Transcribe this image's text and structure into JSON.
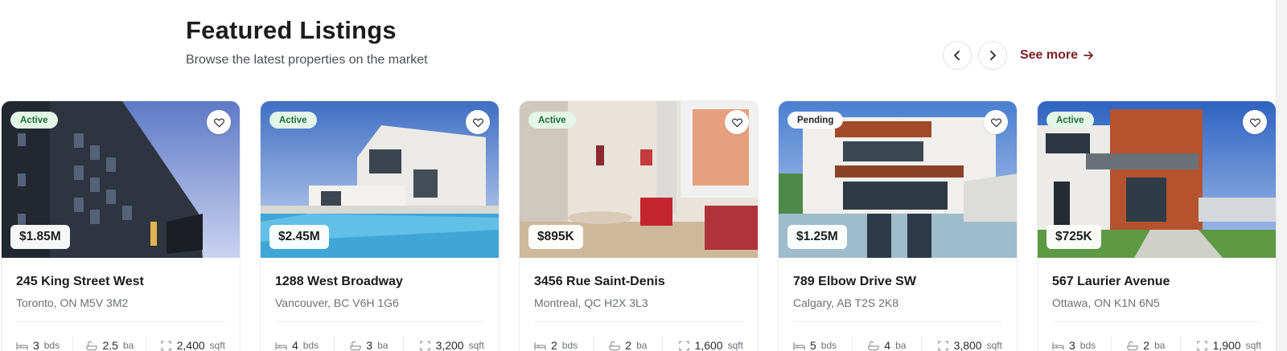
{
  "header": {
    "title": "Featured Listings",
    "subtitle": "Browse the latest properties on the market"
  },
  "controls": {
    "see_more_label": "See more",
    "see_more_color": "#7a1f24"
  },
  "listings": [
    {
      "status": "Active",
      "price": "$1.85M",
      "address": "245 King Street West",
      "city": "Toronto, ON M5V 3M2",
      "beds": "3",
      "beds_unit": "bds",
      "baths": "2.5",
      "baths_unit": "ba",
      "area": "2,400",
      "area_unit": "sqft"
    },
    {
      "status": "Active",
      "price": "$2.45M",
      "address": "1288 West Broadway",
      "city": "Vancouver, BC V6H 1G6",
      "beds": "4",
      "beds_unit": "bds",
      "baths": "3",
      "baths_unit": "ba",
      "area": "3,200",
      "area_unit": "sqft"
    },
    {
      "status": "Active",
      "price": "$895K",
      "address": "3456 Rue Saint-Denis",
      "city": "Montreal, QC H2X 3L3",
      "beds": "2",
      "beds_unit": "bds",
      "baths": "2",
      "baths_unit": "ba",
      "area": "1,600",
      "area_unit": "sqft"
    },
    {
      "status": "Pending",
      "price": "$1.25M",
      "address": "789 Elbow Drive SW",
      "city": "Calgary, AB T2S 2K8",
      "beds": "5",
      "beds_unit": "bds",
      "baths": "4",
      "baths_unit": "ba",
      "area": "3,800",
      "area_unit": "sqft"
    },
    {
      "status": "Active",
      "price": "$725K",
      "address": "567 Laurier Avenue",
      "city": "Ottawa, ON K1N 6N5",
      "beds": "3",
      "beds_unit": "bds",
      "baths": "2",
      "baths_unit": "ba",
      "area": "1,900",
      "area_unit": "sqft"
    }
  ],
  "icons": {
    "prev": "chevron-left-icon",
    "next": "chevron-right-icon",
    "see_more": "arrow-right-icon",
    "favorite": "heart-icon",
    "beds": "bed-icon",
    "baths": "bath-icon",
    "area": "area-icon"
  },
  "colors": {
    "active_badge_bg": "#e3f6e8",
    "active_badge_text": "#1f6b3a",
    "pending_badge_bg": "#ffffff"
  }
}
